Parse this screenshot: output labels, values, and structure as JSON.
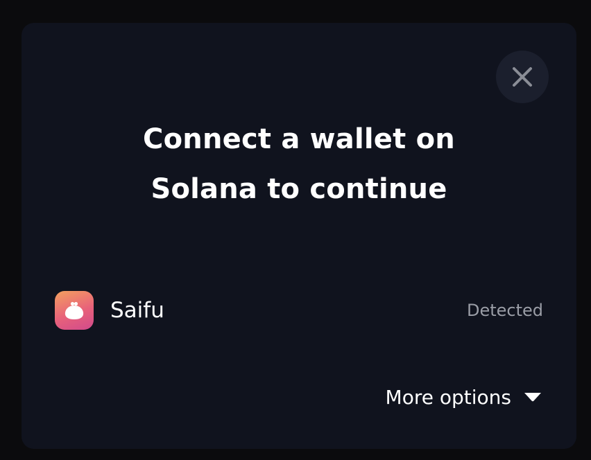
{
  "modal": {
    "title_line1": "Connect a wallet on",
    "title_line2": "Solana to continue",
    "close_icon": "close-icon"
  },
  "wallets": [
    {
      "name": "Saifu",
      "status": "Detected",
      "icon": "saifu-logo-icon"
    }
  ],
  "more_options": {
    "label": "More options",
    "icon": "caret-down-icon"
  },
  "colors": {
    "page_background": "#0b0b0d",
    "modal_background": "#10131e",
    "close_button_background": "#1b1f2d",
    "text_primary": "#ffffff",
    "text_secondary": "#9a9da6"
  }
}
